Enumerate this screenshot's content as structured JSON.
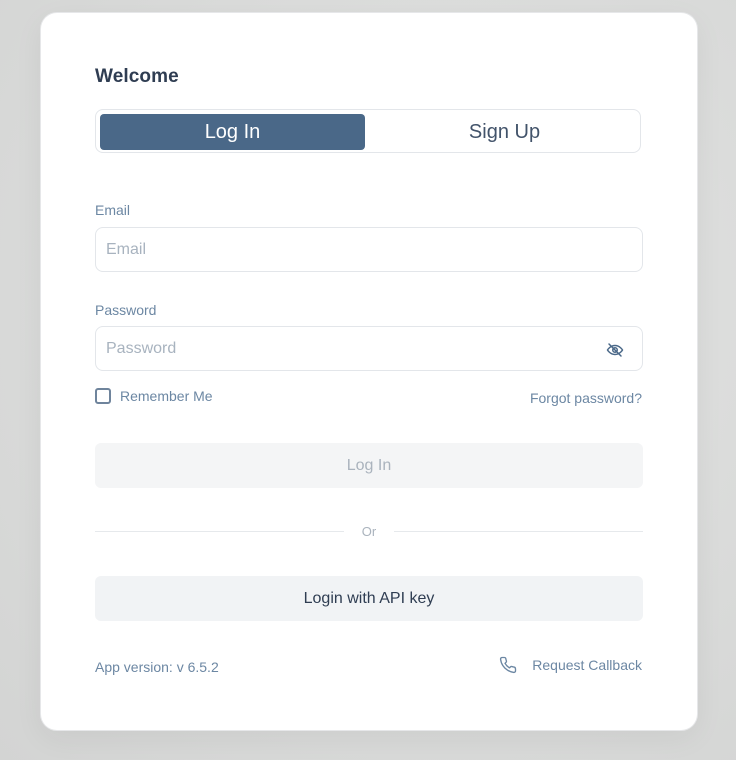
{
  "form": {
    "title": "Welcome",
    "tabs": [
      {
        "label": "Log In",
        "active": true
      },
      {
        "label": "Sign Up",
        "active": false
      }
    ],
    "email": {
      "label": "Email",
      "placeholder": "Email",
      "value": ""
    },
    "password": {
      "label": "Password",
      "placeholder": "Password",
      "value": "",
      "toggle_icon": "eye-off-icon"
    },
    "remember_me": {
      "label": "Remember Me",
      "checked": false
    },
    "forgot_password": "Forgot password?",
    "login_button": "Log In",
    "divider": "Or",
    "api_key_button": "Login with API key"
  },
  "footer": {
    "version": "App version: v 6.5.2",
    "callback": {
      "label": "Request Callback",
      "icon": "phone-icon"
    }
  },
  "colors": {
    "accent": "#4a6888",
    "label": "#6c87a3",
    "heading": "#2f3d52",
    "disabled_text": "#aab3bd"
  }
}
